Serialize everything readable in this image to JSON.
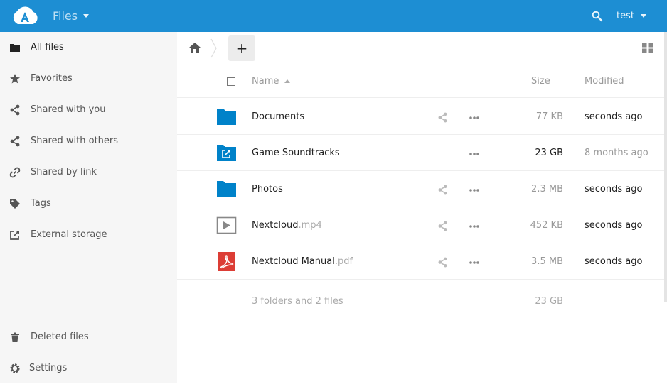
{
  "header": {
    "app_title": "Files",
    "user": "test",
    "accent_color": "#1d8ed3"
  },
  "sidebar": {
    "items": [
      {
        "label": "All files",
        "icon": "folder-icon",
        "active": true
      },
      {
        "label": "Favorites",
        "icon": "star-icon"
      },
      {
        "label": "Shared with you",
        "icon": "share-icon"
      },
      {
        "label": "Shared with others",
        "icon": "share-icon"
      },
      {
        "label": "Shared by link",
        "icon": "link-icon"
      },
      {
        "label": "Tags",
        "icon": "tag-icon"
      },
      {
        "label": "External storage",
        "icon": "external-icon"
      }
    ],
    "deleted_files": "Deleted files",
    "settings": "Settings"
  },
  "controls": {
    "new_label": "+"
  },
  "list": {
    "columns": {
      "name": "Name",
      "size": "Size",
      "modified": "Modified"
    },
    "files": [
      {
        "name": "Documents",
        "ext": "",
        "icon": "folder-icon",
        "size": "77 KB",
        "modified": "seconds ago",
        "shareable": true
      },
      {
        "name": "Game Soundtracks",
        "ext": "",
        "icon": "external-folder-icon",
        "size": "23 GB",
        "modified": "8 months ago",
        "shareable": false
      },
      {
        "name": "Photos",
        "ext": "",
        "icon": "folder-icon",
        "size": "2.3 MB",
        "modified": "seconds ago",
        "shareable": true
      },
      {
        "name": "Nextcloud",
        "ext": ".mp4",
        "icon": "video-icon",
        "size": "452 KB",
        "modified": "seconds ago",
        "shareable": true
      },
      {
        "name": "Nextcloud Manual",
        "ext": ".pdf",
        "icon": "pdf-icon",
        "size": "3.5 MB",
        "modified": "seconds ago",
        "shareable": true
      }
    ],
    "summary": {
      "text": "3 folders and 2 files",
      "size": "23 GB"
    }
  }
}
